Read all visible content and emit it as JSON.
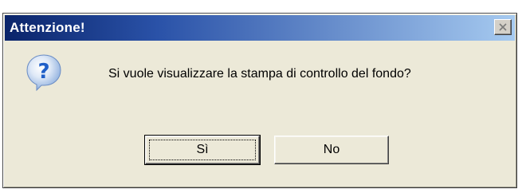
{
  "dialog": {
    "title": "Attenzione!",
    "message": "Si vuole visualizzare la stampa di controllo del fondo?",
    "icon": "question-icon",
    "buttons": {
      "yes_label": "Sì",
      "no_label": "No"
    }
  },
  "colors": {
    "titlebar_start": "#0a246a",
    "titlebar_end": "#a6caf0",
    "dialog_background": "#ece9d8",
    "icon_blue": "#1f5fc8"
  }
}
